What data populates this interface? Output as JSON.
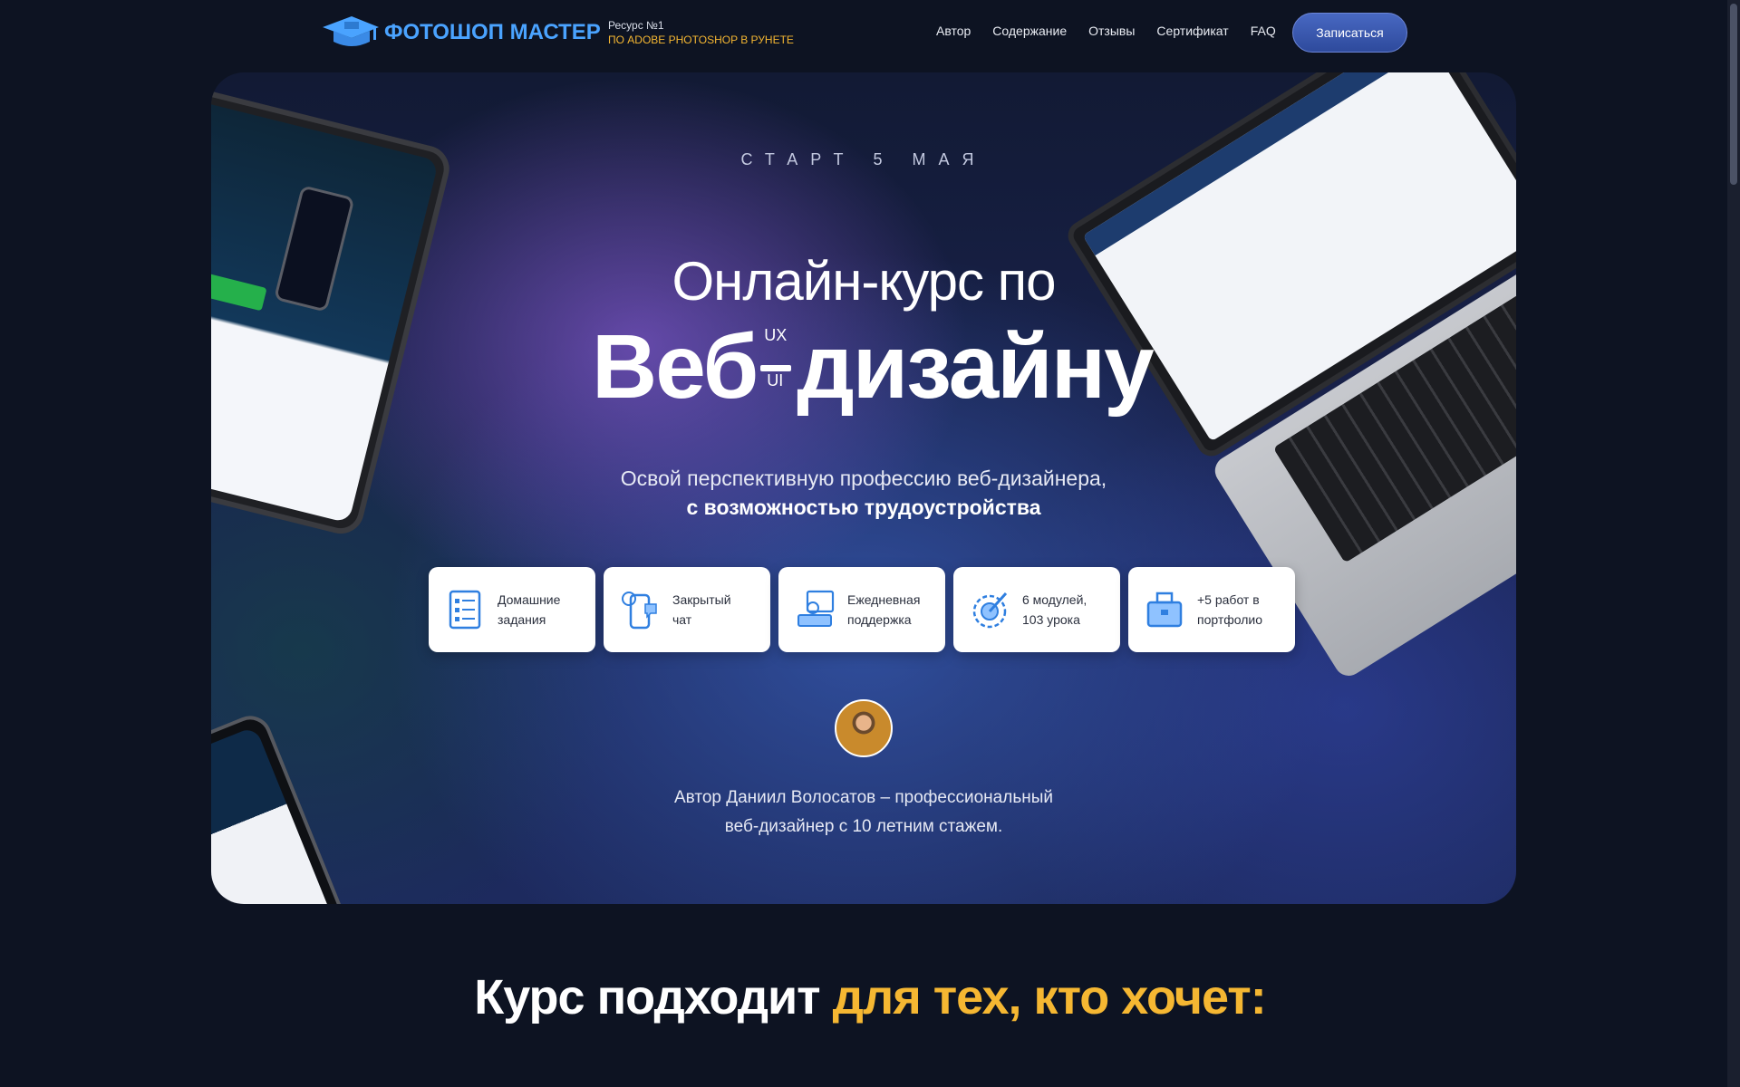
{
  "header": {
    "logo_text": "ФОТОШОП МАСТЕР",
    "tagline_line1": "Ресурс №1",
    "tagline_line2": "ПО ADOBE PHOTOSHOP В РУНЕТЕ",
    "nav": [
      "Автор",
      "Содержание",
      "Отзывы",
      "Сертификат",
      "FAQ"
    ],
    "cta_label": "Записаться"
  },
  "hero": {
    "start_label": "СТАРТ 5 МАЯ",
    "title_line1": "Онлайн-курс по",
    "title_part_left": "Веб",
    "title_part_right": "дизайну",
    "dash_top": "UX",
    "dash_bottom": "UI",
    "subtitle_line1": "Освой перспективную профессию веб-дизайнера,",
    "subtitle_line2": "с возможностью трудоустройства",
    "features": [
      {
        "icon": "homework-icon",
        "line1": "Домашние",
        "line2": "задания"
      },
      {
        "icon": "chat-icon",
        "line1": "Закрытый",
        "line2": "чат"
      },
      {
        "icon": "support-icon",
        "line1": "Ежедневная",
        "line2": "поддержка"
      },
      {
        "icon": "modules-icon",
        "line1": "6 модулей,",
        "line2": "103 урока"
      },
      {
        "icon": "portfolio-icon",
        "line1": "+5 работ в",
        "line2": "портфолио"
      }
    ],
    "author_line1": "Автор Даниил Волосатов – профессиональный",
    "author_line2": "веб-дизайнер с 10 летним стажем."
  },
  "section": {
    "title_white": "Курс подходит",
    "title_accent": "для тех, кто хочет:"
  },
  "colors": {
    "accent": "#f5b732",
    "brand_blue": "#4aa3ff",
    "background": "#0d1322",
    "cta": "#3b5bb5"
  }
}
